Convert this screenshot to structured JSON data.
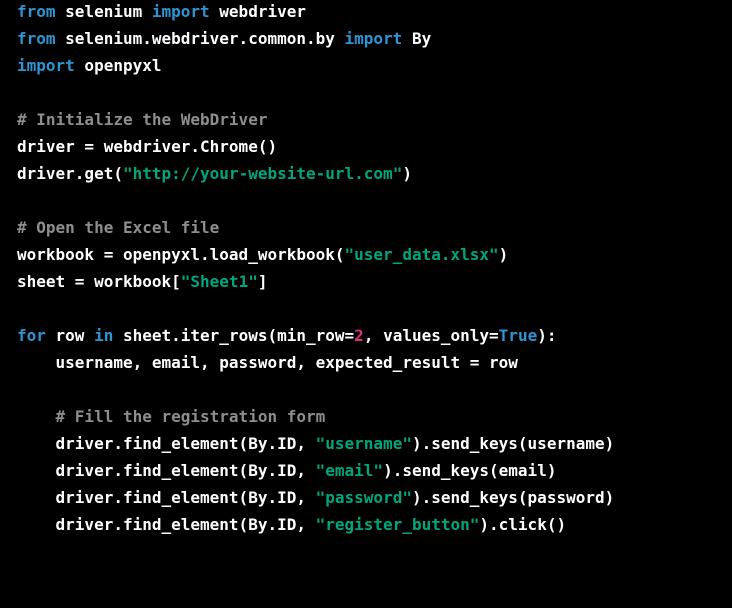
{
  "colors": {
    "background": "#000000",
    "text": "#ffffff",
    "keyword": "#2e95d3",
    "string": "#00a67d",
    "number": "#df3079",
    "comment": "#8e8e8e"
  },
  "code": {
    "l1": {
      "k1": "from",
      "t1": " selenium ",
      "k2": "import",
      "t2": " webdriver"
    },
    "l2": {
      "k1": "from",
      "t1": " selenium.webdriver.common.by ",
      "k2": "import",
      "t2": " By"
    },
    "l3": {
      "k1": "import",
      "t1": " openpyxl"
    },
    "l4": "",
    "l5": {
      "c": "# Initialize the WebDriver"
    },
    "l6": {
      "t1": "driver = webdriver.Chrome()"
    },
    "l7": {
      "t1": "driver.get(",
      "s1": "\"http://your-website-url.com\"",
      "t2": ")"
    },
    "l8": "",
    "l9": {
      "c": "# Open the Excel file"
    },
    "l10": {
      "t1": "workbook = openpyxl.load_workbook(",
      "s1": "\"user_data.xlsx\"",
      "t2": ")"
    },
    "l11": {
      "t1": "sheet = workbook[",
      "s1": "\"Sheet1\"",
      "t2": "]"
    },
    "l12": "",
    "l13": {
      "k1": "for",
      "t1": " row ",
      "k2": "in",
      "t2": " sheet.iter_rows(min_row=",
      "n1": "2",
      "t3": ", values_only=",
      "k3": "True",
      "t4": "):"
    },
    "l14": {
      "t1": "    username, email, password, expected_result = row"
    },
    "l15": "",
    "l16": {
      "c": "    # Fill the registration form"
    },
    "l17": {
      "t1": "    driver.find_element(By.ID, ",
      "s1": "\"username\"",
      "t2": ").send_keys(username)"
    },
    "l18": {
      "t1": "    driver.find_element(By.ID, ",
      "s1": "\"email\"",
      "t2": ").send_keys(email)"
    },
    "l19": {
      "t1": "    driver.find_element(By.ID, ",
      "s1": "\"password\"",
      "t2": ").send_keys(password)"
    },
    "l20": {
      "t1": "    driver.find_element(By.ID, ",
      "s1": "\"register_button\"",
      "t2": ").click()"
    }
  }
}
